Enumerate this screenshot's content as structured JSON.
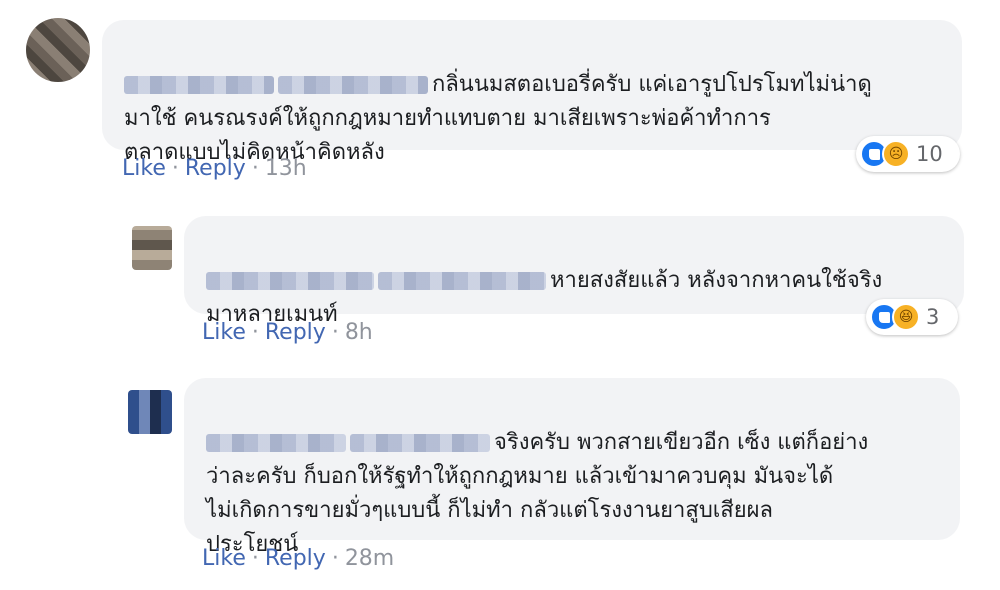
{
  "comments": [
    {
      "text": "กลิ่นนมสตอเบอรี่ครับ แค่เอารูปโปรโมทไม่น่าดู\nมาใช้ คนรณรงค์ให้ถูกกฎหมายทำแทบตาย มาเสียเพราะพ่อค้าทำการ\nตลาดแบบไม่คิดหน้าคิดหลัง",
      "like_label": "Like",
      "reply_label": "Reply",
      "time": "13h",
      "reaction_count": "10",
      "reactions": [
        "like-icon",
        "sad-icon"
      ]
    },
    {
      "text": "หายสงสัยแล้ว หลังจากหาคนใช้จริง\nมาหลายเมนท์",
      "like_label": "Like",
      "reply_label": "Reply",
      "time": "8h",
      "reaction_count": "3",
      "reactions": [
        "like-icon",
        "haha-icon"
      ]
    },
    {
      "text": "จริงครับ พวกสายเขียวอีก เซ็ง แต่ก็อย่าง\nว่าละครับ ก็บอกให้รัฐทำให้ถูกกฎหมาย แล้วเข้ามาควบคุม มันจะได้\nไม่เกิดการขายมั่วๆแบบนี้ ก็ไม่ทำ กลัวแต่โรงงานยาสูบเสียผล\nประโยชน์",
      "like_label": "Like",
      "reply_label": "Reply",
      "time": "28m"
    }
  ],
  "separator": "·",
  "colors": {
    "bubble": "#f2f3f5",
    "link": "#4267b2",
    "like_blue": "#1877f2",
    "emoji": "#f7b125"
  }
}
